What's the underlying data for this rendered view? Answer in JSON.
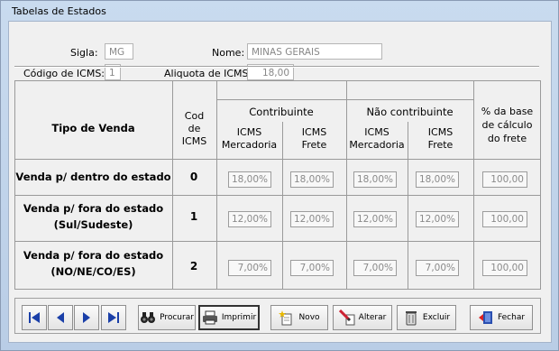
{
  "window": {
    "title": "Tabelas de Estados"
  },
  "form": {
    "sigla_label": "Sigla:",
    "sigla_value": "MG",
    "nome_label": "Nome:",
    "nome_value": "MINAS GERAIS",
    "codigo_label": "Código de ICMS:",
    "codigo_value": "1",
    "aliquota_label": "Aliquota de ICMS:",
    "aliquota_value": "18,00"
  },
  "table": {
    "tipo_header": "Tipo de Venda",
    "cod_header": [
      "Cod",
      "de",
      "ICMS"
    ],
    "contrib_header": "Contribuinte",
    "nao_contrib_header": "Não contribuinte",
    "base_header": [
      "% da base",
      "de cálculo",
      "do frete"
    ],
    "sub": {
      "icms": "ICMS",
      "mercadoria": "Mercadoria",
      "frete": "Frete"
    },
    "rows": [
      {
        "label": [
          "Venda p/ dentro do estado"
        ],
        "cod": "0",
        "values": [
          "18,00%",
          "18,00%",
          "18,00%",
          "18,00%",
          "100,00"
        ]
      },
      {
        "label": [
          "Venda p/ fora do estado",
          "(Sul/Sudeste)"
        ],
        "cod": "1",
        "values": [
          "12,00%",
          "12,00%",
          "12,00%",
          "12,00%",
          "100,00"
        ]
      },
      {
        "label": [
          "Venda p/ fora do estado",
          "(NO/NE/CO/ES)"
        ],
        "cod": "2",
        "values": [
          "7,00%",
          "7,00%",
          "7,00%",
          "7,00%",
          "100,00"
        ]
      }
    ]
  },
  "toolbar": {
    "procurar": "Procurar",
    "imprimir": "Imprimir",
    "novo": "Novo",
    "alterar": "Alterar",
    "excluir": "Excluir",
    "fechar": "Fechar"
  },
  "colors": {
    "nav_blue": "#1a3fa8",
    "frame": "#b9cde6"
  }
}
